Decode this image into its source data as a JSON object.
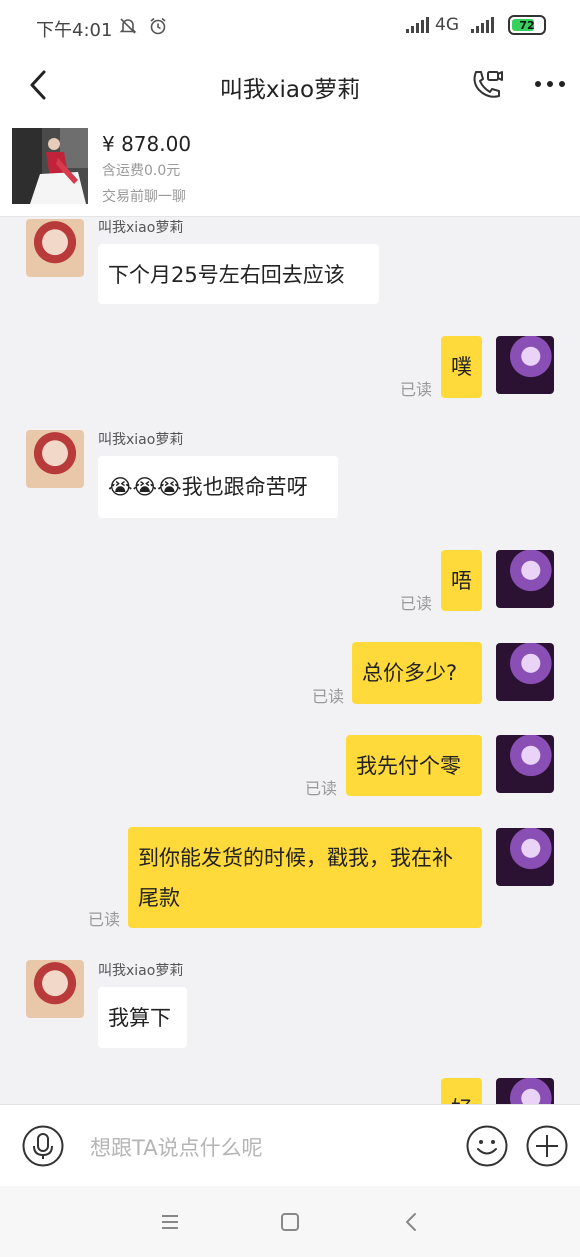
{
  "status_bar": {
    "time": "下午4:01",
    "network": "4G",
    "battery": "72"
  },
  "header": {
    "title": "叫我xiao萝莉"
  },
  "product": {
    "price": "¥ 878.00",
    "shipping": "含运费0.0元",
    "hint": "交易前聊一聊"
  },
  "messages": [
    {
      "side": "peer",
      "sender": "叫我xiao萝莉",
      "text": "下个月25号左右回去应该"
    },
    {
      "side": "me",
      "text": "噗",
      "read": "已读"
    },
    {
      "side": "peer",
      "sender": "叫我xiao萝莉",
      "text": "😭😭😭我也跟命苦呀"
    },
    {
      "side": "me",
      "text": "唔",
      "read": "已读"
    },
    {
      "side": "me",
      "text": "总价多少?",
      "read": "已读"
    },
    {
      "side": "me",
      "text": "我先付个零",
      "read": "已读"
    },
    {
      "side": "me",
      "text": "到你能发货的时候，戳我，我在补尾款",
      "read": "已读"
    },
    {
      "side": "peer",
      "sender": "叫我xiao萝莉",
      "text": "我算下"
    },
    {
      "side": "me",
      "text": "好",
      "read": ""
    }
  ],
  "input": {
    "placeholder": "想跟TA说点什么呢"
  },
  "icons": {
    "back": "chevron-left-icon",
    "call": "video-call-icon",
    "more": "more-icon",
    "mic": "microphone-icon",
    "emoji": "emoji-icon",
    "plus": "plus-icon"
  },
  "colors": {
    "my_bubble": "#ffda3a",
    "peer_bubble": "#ffffff",
    "background": "#f2f2f5",
    "battery": "#36d15d"
  }
}
